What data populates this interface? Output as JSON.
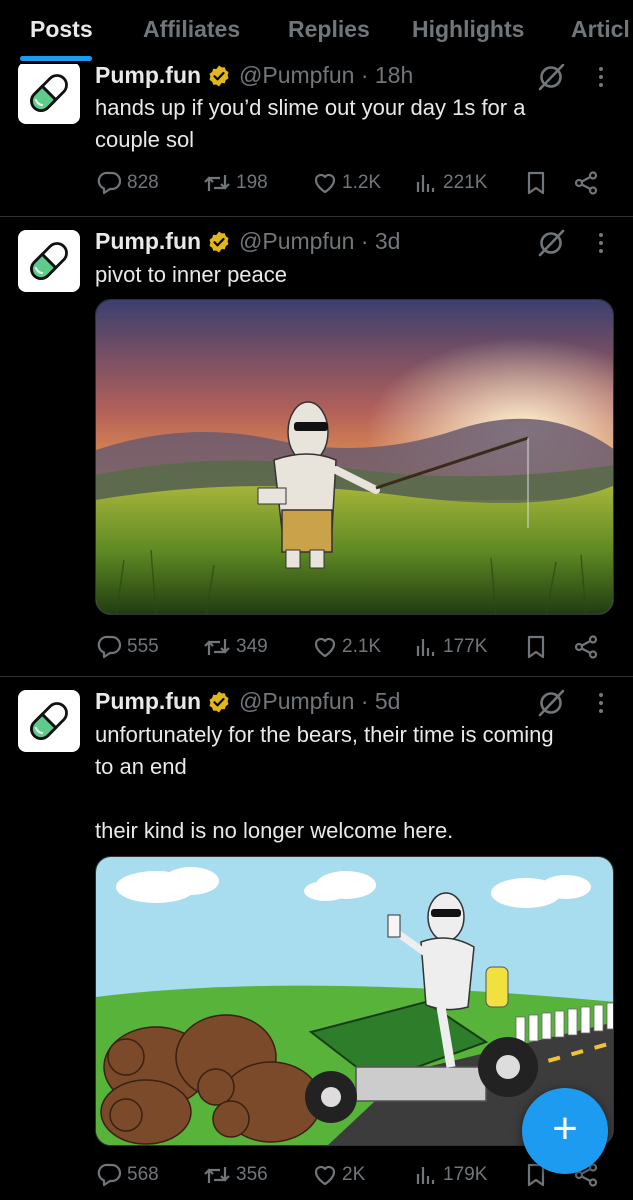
{
  "tabs": [
    {
      "label": "Posts",
      "active": true
    },
    {
      "label": "Affiliates",
      "active": false
    },
    {
      "label": "Replies",
      "active": false
    },
    {
      "label": "Highlights",
      "active": false
    },
    {
      "label": "Articl",
      "active": false
    }
  ],
  "colors": {
    "accent": "#1d9bf0",
    "verified": "#e2b719",
    "muted": "#71767b",
    "background": "#000000"
  },
  "posts": [
    {
      "name": "Pump.fun",
      "handle_time": "@Pumpfun · 18h",
      "text": "hands up if you’d slime out your day 1s for a couple sol",
      "stats": {
        "replies": "828",
        "reposts": "198",
        "likes": "1.2K",
        "views": "221K"
      }
    },
    {
      "name": "Pump.fun",
      "handle_time": "@Pumpfun · 3d",
      "text": "pivot to inner peace",
      "media": "sunset-meadow-fishing-image",
      "stats": {
        "replies": "555",
        "reposts": "349",
        "likes": "2.1K",
        "views": "177K"
      }
    },
    {
      "name": "Pump.fun",
      "handle_time": "@Pumpfun · 5d",
      "text_line1": "unfortunately for the bears, their time is coming to an end",
      "text_line2": "their kind is no longer welcome here.",
      "media": "lawnmower-bears-image",
      "stats": {
        "replies": "568",
        "reposts": "356",
        "likes": "2K",
        "views": "179K"
      }
    }
  ],
  "icons": {
    "avatar": "pill-icon",
    "verified": "verified-badge-icon",
    "grok": "grok-icon",
    "more": "more-icon",
    "reply": "reply-icon",
    "repost": "repost-icon",
    "like": "heart-icon",
    "views": "views-icon",
    "bookmark": "bookmark-icon",
    "share": "share-icon",
    "compose": "plus-icon"
  },
  "fab": {
    "label": "+"
  }
}
